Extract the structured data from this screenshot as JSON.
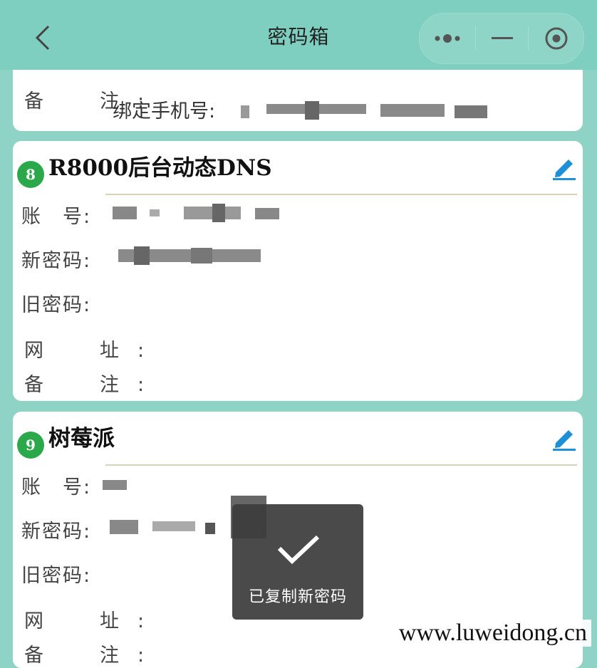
{
  "app": {
    "title": "密码箱"
  },
  "labels": {
    "account": "账　号:",
    "new_password": "新密码:",
    "old_password": "旧密码:",
    "url": "网　址:",
    "note": "备　注:"
  },
  "previous_entry": {
    "note_label": "备　注:",
    "note_value": "绑定手机号:"
  },
  "entries": [
    {
      "index": "8",
      "title": "R8000后台动态DNS"
    },
    {
      "index": "9",
      "title": "树莓派"
    }
  ],
  "toast": {
    "message": "已复制新密码"
  },
  "watermark": "www.luweidong.cn",
  "colors": {
    "accent": "#7fcfc0",
    "badge": "#2aa84a",
    "edit": "#1e90d8"
  },
  "icons": [
    "chevron-left-icon",
    "more-dots-icon",
    "minimize-icon",
    "close-target-icon",
    "edit-pencil-icon",
    "checkmark-icon"
  ]
}
